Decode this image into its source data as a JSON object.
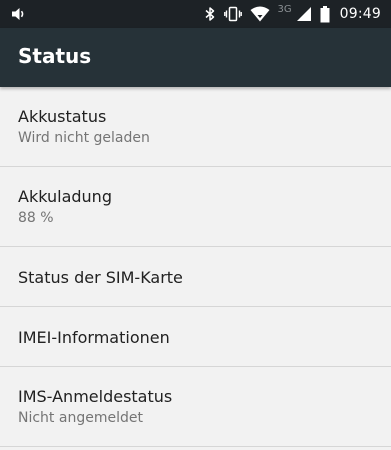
{
  "status_bar": {
    "network_type": "3G",
    "time": "09:49",
    "icons": [
      "volume-icon",
      "bluetooth-icon",
      "vibrate-icon",
      "wifi-icon",
      "cell-signal-icon",
      "battery-icon"
    ],
    "battery_level": 0.88
  },
  "toolbar": {
    "title": "Status",
    "background": "#263238"
  },
  "items": [
    {
      "title": "Akkustatus",
      "summary": "Wird nicht geladen"
    },
    {
      "title": "Akkuladung",
      "summary": "88 %"
    },
    {
      "title": "Status der SIM-Karte"
    },
    {
      "title": "IMEI-Informationen"
    },
    {
      "title": "IMS-Anmeldestatus",
      "summary": "Nicht angemeldet"
    }
  ]
}
